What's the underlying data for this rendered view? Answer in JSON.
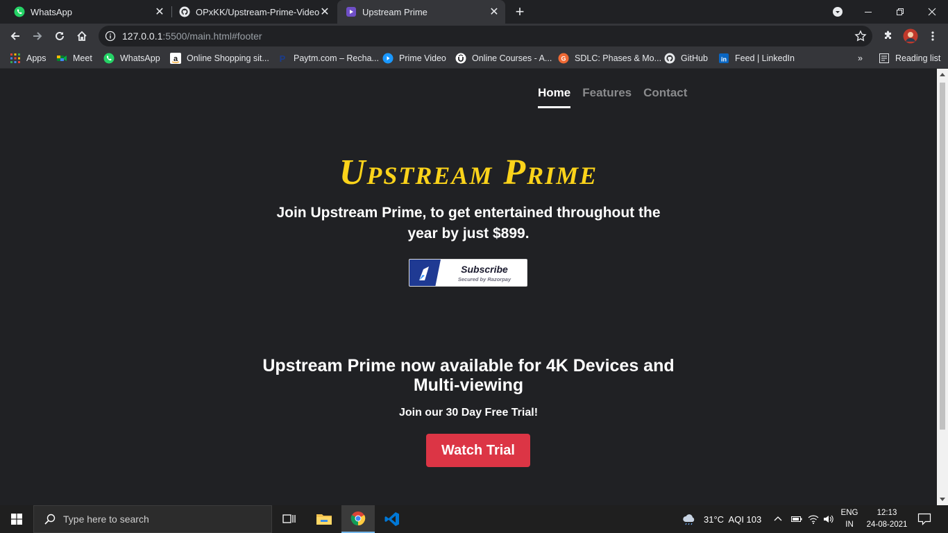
{
  "browser": {
    "tabs": [
      {
        "title": "WhatsApp",
        "icon": "whatsapp-icon",
        "active": false
      },
      {
        "title": "OPxKK/Upstream-Prime-Video-u",
        "icon": "github-icon",
        "active": false
      },
      {
        "title": "Upstream Prime",
        "icon": "prime-video-icon",
        "active": true
      }
    ],
    "url_host": "127.0.0.1",
    "url_rest": ":5500/main.html#footer",
    "bookmarks": [
      {
        "label": "Apps",
        "icon": "apps-grid-icon"
      },
      {
        "label": "Meet",
        "icon": "meet-icon"
      },
      {
        "label": "WhatsApp",
        "icon": "whatsapp-icon"
      },
      {
        "label": "Online Shopping sit...",
        "icon": "amazon-icon"
      },
      {
        "label": "Paytm.com – Recha...",
        "icon": "paytm-icon"
      },
      {
        "label": "Prime Video",
        "icon": "prime-video-icon"
      },
      {
        "label": "Online Courses - A...",
        "icon": "udemy-icon"
      },
      {
        "label": "SDLC: Phases & Mo...",
        "icon": "sdlc-icon"
      },
      {
        "label": "GitHub",
        "icon": "github-icon"
      },
      {
        "label": "Feed | LinkedIn",
        "icon": "linkedin-icon"
      }
    ],
    "overflow_label": "»",
    "reading_list": "Reading list"
  },
  "site": {
    "nav": [
      {
        "label": "Home",
        "active": true
      },
      {
        "label": "Features",
        "active": false
      },
      {
        "label": "Contact",
        "active": false
      }
    ],
    "brand": "Upstream Prime",
    "tagline": "Join Upstream Prime, to get entertained throughout the year by just $899.",
    "subscribe_label": "Subscribe",
    "subscribe_secured": "Secured by Razorpay",
    "promo_title": "Upstream Prime now available for 4K Devices and Multi-viewing",
    "promo_sub": "Join our 30 Day Free Trial!",
    "trial_button": "Watch Trial"
  },
  "taskbar": {
    "search_placeholder": "Type here to search",
    "weather": "31°C  AQI 103",
    "lang_line1": "ENG",
    "lang_line2": "IN",
    "time": "12:13",
    "date": "24-08-2021"
  },
  "colors": {
    "brand_yellow": "#fbd31a",
    "trial_red": "#dc3545",
    "page_bg": "#202124"
  }
}
